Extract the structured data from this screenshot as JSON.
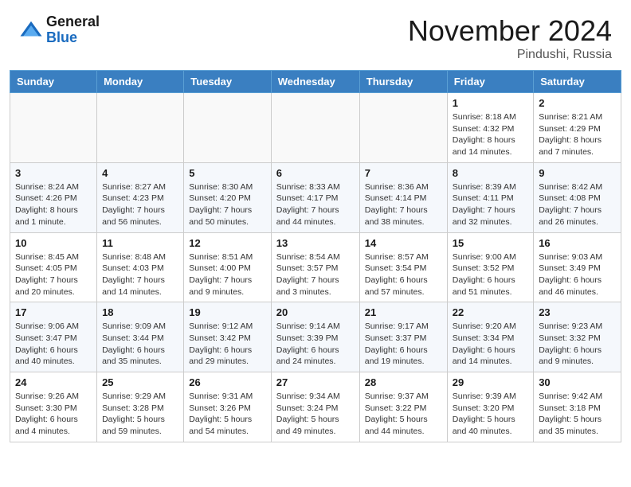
{
  "header": {
    "logo_general": "General",
    "logo_blue": "Blue",
    "month_title": "November 2024",
    "location": "Pindushi, Russia"
  },
  "weekdays": [
    "Sunday",
    "Monday",
    "Tuesday",
    "Wednesday",
    "Thursday",
    "Friday",
    "Saturday"
  ],
  "weeks": [
    [
      {
        "day": "",
        "info": ""
      },
      {
        "day": "",
        "info": ""
      },
      {
        "day": "",
        "info": ""
      },
      {
        "day": "",
        "info": ""
      },
      {
        "day": "",
        "info": ""
      },
      {
        "day": "1",
        "info": "Sunrise: 8:18 AM\nSunset: 4:32 PM\nDaylight: 8 hours and 14 minutes."
      },
      {
        "day": "2",
        "info": "Sunrise: 8:21 AM\nSunset: 4:29 PM\nDaylight: 8 hours and 7 minutes."
      }
    ],
    [
      {
        "day": "3",
        "info": "Sunrise: 8:24 AM\nSunset: 4:26 PM\nDaylight: 8 hours and 1 minute."
      },
      {
        "day": "4",
        "info": "Sunrise: 8:27 AM\nSunset: 4:23 PM\nDaylight: 7 hours and 56 minutes."
      },
      {
        "day": "5",
        "info": "Sunrise: 8:30 AM\nSunset: 4:20 PM\nDaylight: 7 hours and 50 minutes."
      },
      {
        "day": "6",
        "info": "Sunrise: 8:33 AM\nSunset: 4:17 PM\nDaylight: 7 hours and 44 minutes."
      },
      {
        "day": "7",
        "info": "Sunrise: 8:36 AM\nSunset: 4:14 PM\nDaylight: 7 hours and 38 minutes."
      },
      {
        "day": "8",
        "info": "Sunrise: 8:39 AM\nSunset: 4:11 PM\nDaylight: 7 hours and 32 minutes."
      },
      {
        "day": "9",
        "info": "Sunrise: 8:42 AM\nSunset: 4:08 PM\nDaylight: 7 hours and 26 minutes."
      }
    ],
    [
      {
        "day": "10",
        "info": "Sunrise: 8:45 AM\nSunset: 4:05 PM\nDaylight: 7 hours and 20 minutes."
      },
      {
        "day": "11",
        "info": "Sunrise: 8:48 AM\nSunset: 4:03 PM\nDaylight: 7 hours and 14 minutes."
      },
      {
        "day": "12",
        "info": "Sunrise: 8:51 AM\nSunset: 4:00 PM\nDaylight: 7 hours and 9 minutes."
      },
      {
        "day": "13",
        "info": "Sunrise: 8:54 AM\nSunset: 3:57 PM\nDaylight: 7 hours and 3 minutes."
      },
      {
        "day": "14",
        "info": "Sunrise: 8:57 AM\nSunset: 3:54 PM\nDaylight: 6 hours and 57 minutes."
      },
      {
        "day": "15",
        "info": "Sunrise: 9:00 AM\nSunset: 3:52 PM\nDaylight: 6 hours and 51 minutes."
      },
      {
        "day": "16",
        "info": "Sunrise: 9:03 AM\nSunset: 3:49 PM\nDaylight: 6 hours and 46 minutes."
      }
    ],
    [
      {
        "day": "17",
        "info": "Sunrise: 9:06 AM\nSunset: 3:47 PM\nDaylight: 6 hours and 40 minutes."
      },
      {
        "day": "18",
        "info": "Sunrise: 9:09 AM\nSunset: 3:44 PM\nDaylight: 6 hours and 35 minutes."
      },
      {
        "day": "19",
        "info": "Sunrise: 9:12 AM\nSunset: 3:42 PM\nDaylight: 6 hours and 29 minutes."
      },
      {
        "day": "20",
        "info": "Sunrise: 9:14 AM\nSunset: 3:39 PM\nDaylight: 6 hours and 24 minutes."
      },
      {
        "day": "21",
        "info": "Sunrise: 9:17 AM\nSunset: 3:37 PM\nDaylight: 6 hours and 19 minutes."
      },
      {
        "day": "22",
        "info": "Sunrise: 9:20 AM\nSunset: 3:34 PM\nDaylight: 6 hours and 14 minutes."
      },
      {
        "day": "23",
        "info": "Sunrise: 9:23 AM\nSunset: 3:32 PM\nDaylight: 6 hours and 9 minutes."
      }
    ],
    [
      {
        "day": "24",
        "info": "Sunrise: 9:26 AM\nSunset: 3:30 PM\nDaylight: 6 hours and 4 minutes."
      },
      {
        "day": "25",
        "info": "Sunrise: 9:29 AM\nSunset: 3:28 PM\nDaylight: 5 hours and 59 minutes."
      },
      {
        "day": "26",
        "info": "Sunrise: 9:31 AM\nSunset: 3:26 PM\nDaylight: 5 hours and 54 minutes."
      },
      {
        "day": "27",
        "info": "Sunrise: 9:34 AM\nSunset: 3:24 PM\nDaylight: 5 hours and 49 minutes."
      },
      {
        "day": "28",
        "info": "Sunrise: 9:37 AM\nSunset: 3:22 PM\nDaylight: 5 hours and 44 minutes."
      },
      {
        "day": "29",
        "info": "Sunrise: 9:39 AM\nSunset: 3:20 PM\nDaylight: 5 hours and 40 minutes."
      },
      {
        "day": "30",
        "info": "Sunrise: 9:42 AM\nSunset: 3:18 PM\nDaylight: 5 hours and 35 minutes."
      }
    ]
  ]
}
